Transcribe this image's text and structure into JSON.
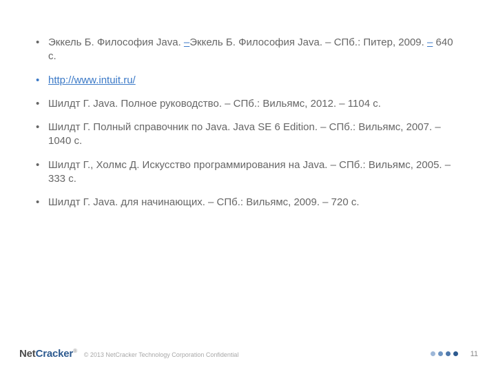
{
  "refs": [
    {
      "segments": [
        {
          "text": "Эккель Б. Философия Java. "
        },
        {
          "text": "–",
          "link": true
        },
        {
          "text": "Эккель Б. Философия Java. – СПб.: Питер, 2009. "
        },
        {
          "text": "–",
          "link": true
        },
        {
          "text": " 640 c."
        }
      ],
      "linkItem": false
    },
    {
      "segments": [
        {
          "text": "http://www.intuit.ru/",
          "link": true,
          "href": true
        }
      ],
      "linkItem": true
    },
    {
      "segments": [
        {
          "text": "Шилдт Г. Java. Полное руководство. – СПб.: Вильямс, 2012. – 1104 с."
        }
      ],
      "linkItem": false
    },
    {
      "segments": [
        {
          "text": "Шилдт Г. Полный справочник по Java. Java SE 6 Edition. – СПб.: Вильямс, 2007. – 1040 с."
        }
      ],
      "linkItem": false
    },
    {
      "segments": [
        {
          "text": "Шилдт Г., Холмс Д. Искусство программирования на Java. – СПб.: Вильямс, 2005. – 333 с."
        }
      ],
      "linkItem": false
    },
    {
      "segments": [
        {
          "text": "Шилдт Г. Java. для начинающих. – СПб.: Вильямс, 2009. – 720 с."
        }
      ],
      "linkItem": false
    }
  ],
  "footer": {
    "logo_net": "Net",
    "logo_cracker": "Cracker",
    "logo_reg": "®",
    "copyright": "© 2013 NetCracker Technology Corporation Confidential",
    "page_number": "11"
  }
}
